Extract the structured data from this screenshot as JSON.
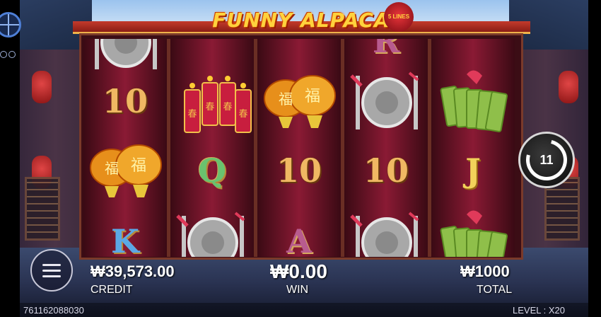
{
  "game": {
    "title": "FUNNY ALPACA",
    "lines_badge": "5 LINES",
    "spin_count": "11"
  },
  "reels": [
    {
      "symbols": [
        {
          "kind": "gong-partial",
          "label": ""
        },
        {
          "kind": "text",
          "label": "10",
          "style": "t-10"
        },
        {
          "kind": "lanterns",
          "label": ""
        },
        {
          "kind": "text",
          "label": "K",
          "style": "t-K"
        }
      ]
    },
    {
      "symbols": [
        {
          "kind": "partial-text",
          "label": "",
          "style": "t-J"
        },
        {
          "kind": "firecrackers",
          "label": ""
        },
        {
          "kind": "text",
          "label": "Q",
          "style": "t-Q"
        },
        {
          "kind": "gong",
          "label": ""
        }
      ]
    },
    {
      "symbols": [
        {
          "kind": "partial-text",
          "label": "",
          "style": "t-Q"
        },
        {
          "kind": "lanterns",
          "label": ""
        },
        {
          "kind": "text",
          "label": "10",
          "style": "t-10"
        },
        {
          "kind": "text",
          "label": "A",
          "style": "t-A"
        }
      ]
    },
    {
      "symbols": [
        {
          "kind": "partial-text",
          "label": "R",
          "style": "t-R"
        },
        {
          "kind": "gong",
          "label": ""
        },
        {
          "kind": "text",
          "label": "10",
          "style": "t-10"
        },
        {
          "kind": "gong",
          "label": ""
        }
      ]
    },
    {
      "symbols": [
        {
          "kind": "partial-text",
          "label": "",
          "style": "t-J"
        },
        {
          "kind": "fan",
          "label": ""
        },
        {
          "kind": "text",
          "label": "J",
          "style": "t-J"
        },
        {
          "kind": "fan",
          "label": ""
        }
      ]
    }
  ],
  "hud": {
    "credit_value": "₩39,573.00",
    "credit_label": "CREDIT",
    "win_value": "₩0.00",
    "win_label": "WIN",
    "total_value": "₩1000",
    "total_label": "TOTAL",
    "round_id": "761162088030",
    "level_label": "LEVEL : X20"
  },
  "icons": {
    "menu": "menu-icon",
    "wheel": "wheel-icon",
    "spin": "autospin-icon"
  }
}
